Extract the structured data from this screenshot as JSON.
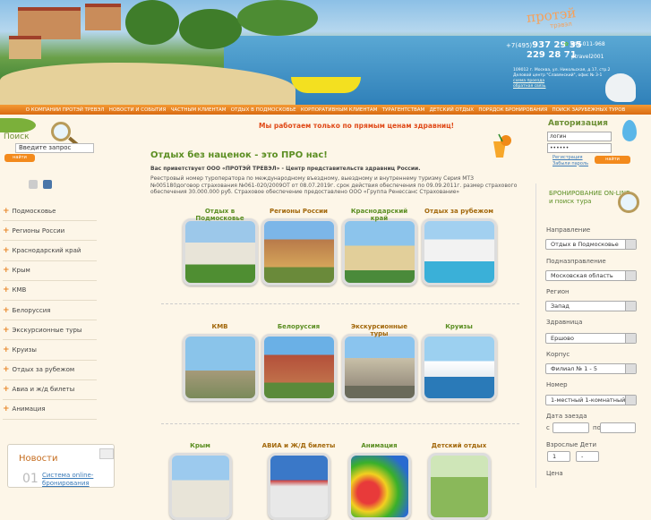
{
  "header": {
    "logo_main": "протэй",
    "logo_sub": "трэвэл",
    "phone1_prefix": "+7(495)",
    "phone1": "937 29 35",
    "phone2": "229 28 71",
    "icq": "642-011-968",
    "skype": "ptravel2001",
    "address": "109012 г. Москва, ул. Никольская, д.17, стр.2",
    "address2": "Деловой центр \"Славянский\", офис № 3-1",
    "link1": "схема проезда",
    "link2": "обратная связь"
  },
  "nav": [
    "О КОМПАНИИ ПРОТЭЙ ТРЕВЭЛ",
    "НОВОСТИ И СОБЫТИЯ",
    "ЧАСТНЫМ КЛИЕНТАМ",
    "ОТДЫХ В ПОДМОСКОВЬЕ",
    "КОРПОРАТИВНЫМ КЛИЕНТАМ",
    "ТУРАГЕНТСТВАМ",
    "ДЕТСКИЙ ОТДЫХ",
    "ПОРЯДОК БРОНИРОВАНИЯ",
    "ПОИСК ЗАРУБЕЖНЫХ ТУРОВ"
  ],
  "search": {
    "title": "Поиск",
    "placeholder": "Введите запрос",
    "button": "найти"
  },
  "sidebar": {
    "items": [
      "Подмосковье",
      "Регионы России",
      "Краснодарский край",
      "Крым",
      "КМВ",
      "Белоруссия",
      "Экскурсионные туры",
      "Круизы",
      "Отдых за рубежом",
      "Авиа и ж/д билеты",
      "Анимация"
    ]
  },
  "news": {
    "title": "Новости",
    "num": "01",
    "link": "Система online-бронирования"
  },
  "main": {
    "promo": "Мы работаем только по прямым ценам здравниц!",
    "heading": "Отдых без наценок - это ПРО нас!",
    "intro_bold": "Вас приветствует ООО «ПРОТЭЙ ТРЕВЭЛ» - Центр представительств здравниц России.",
    "legal": "Реестровый номер туроператора по международному въездному, выездному и внутреннему туризму Серия МТЗ №005180договор страхования №061-020/2009ОТ от 08.07.2019г. срок действия обеспечения по 09.09.2011г. размер страхового обеспечения 30.000.000 руб. Страховое обеспечение предоставлено ООО «Группа Ренессанс Страхование»",
    "cats": [
      {
        "label": "Отдых в Подмосковье",
        "green": true
      },
      {
        "label": "Регионы России",
        "green": false
      },
      {
        "label": "Краснодарский край",
        "green": true
      },
      {
        "label": "Отдых за рубежом",
        "green": false
      },
      {
        "label": "КМВ",
        "green": false
      },
      {
        "label": "Белоруссия",
        "green": true
      },
      {
        "label": "Экскурсионные туры",
        "green": false
      },
      {
        "label": "Круизы",
        "green": true
      },
      {
        "label": "Крым",
        "green": true
      },
      {
        "label": "АВИА и Ж/Д билеты",
        "green": false
      },
      {
        "label": "Анимация",
        "green": true
      },
      {
        "label": "Детский отдых",
        "green": false
      }
    ]
  },
  "auth": {
    "title": "Авторизация",
    "login": "логин",
    "password": "••••••",
    "register": "Регистрация",
    "forgot": "Забыли пароль",
    "button": "найти"
  },
  "booking": {
    "title1": "БРОНИРОВАНИЕ ON-LINE",
    "title2": "и поиск тура",
    "direction_label": "Направление",
    "direction": "Отдых в Подмосковье",
    "subdirection_label": "Подназправление",
    "subdirection": "Московская область",
    "region_label": "Регион",
    "region": "Запад",
    "resort_label": "Здравница",
    "resort": "Ершово",
    "building_label": "Корпус",
    "building": "Филиал № 1 - 5",
    "room_label": "Номер",
    "room": "1-местный 1-комнатный «Э",
    "date_label": "Дата заезда",
    "from": "с",
    "to": "по",
    "adults_label": "Взрослые Дети",
    "adults": "1",
    "children": "-",
    "price_label": "Цена"
  },
  "colors": {
    "accent": "#f38a1c",
    "green": "#5b8e22",
    "promo": "#e04a18"
  }
}
